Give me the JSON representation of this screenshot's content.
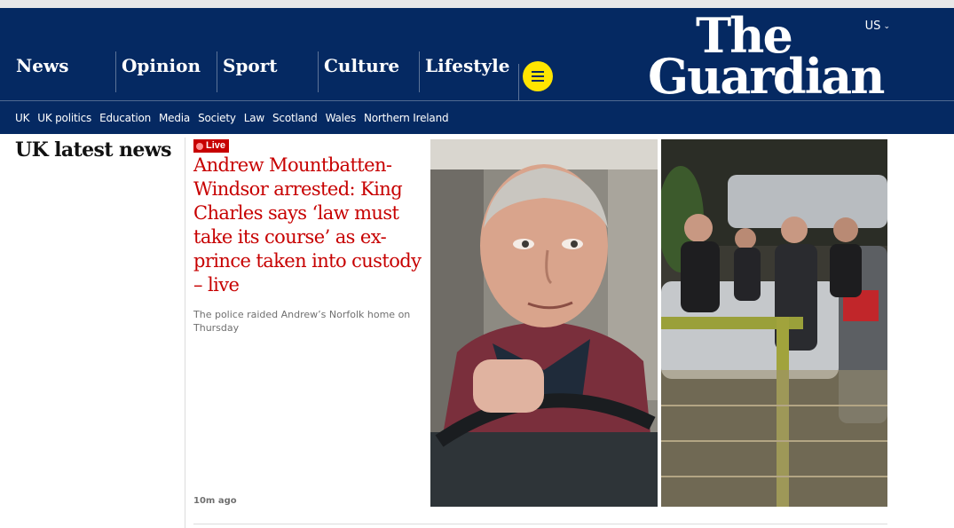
{
  "header": {
    "edition": "US",
    "logo_line1": "The",
    "logo_line2": "Guardian",
    "pillars": [
      "News",
      "Opinion",
      "Sport",
      "Culture",
      "Lifestyle"
    ]
  },
  "subnav": {
    "links": [
      "UK",
      "UK politics",
      "Education",
      "Media",
      "Society",
      "Law",
      "Scotland",
      "Wales",
      "Northern Ireland"
    ]
  },
  "section": {
    "title": "UK latest news"
  },
  "story": {
    "badge": "Live",
    "headline": "Andrew Mountbatten-Windsor arrested: King Charles says ‘law must take its course’ as ex-prince taken into custody – live",
    "standfirst": "The police raided Andrew’s Norfolk home on Thursday",
    "timestamp": "10m ago"
  },
  "colors": {
    "brand_blue": "#052962",
    "live_red": "#c70000",
    "menu_yellow": "#ffe500"
  }
}
